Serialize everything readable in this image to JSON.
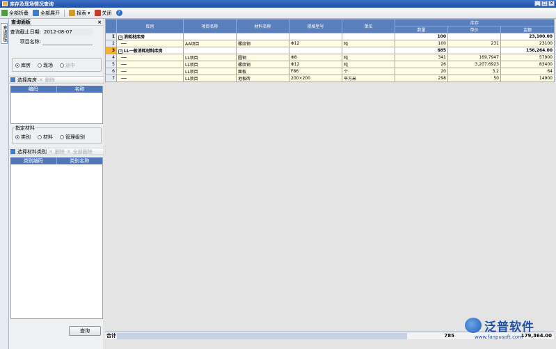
{
  "window": {
    "title": "库存及现场情况查询"
  },
  "toolbar": {
    "expand_all": "全部折叠",
    "collapse_all": "全部展开",
    "report": "报表",
    "close": "关闭",
    "help": "?"
  },
  "side_tab": {
    "label": "查询面板"
  },
  "panel": {
    "title": "查询面板",
    "close": "×",
    "date_label": "查询截止日期:",
    "date_value": "2012-08-07",
    "project_label": "项目名称:",
    "project_value": "",
    "scope_options": [
      "库房",
      "现场",
      "途中"
    ],
    "scope_selected": "库房",
    "select_warehouse": "选择库房",
    "delete": "删除",
    "wh_cols": [
      "编码",
      "名称"
    ],
    "material_group_title": "指定材料",
    "material_options": [
      "类别",
      "材料",
      "管理级别"
    ],
    "material_selected": "类别",
    "select_category": "选择材料类别",
    "delete_all": "全部删除",
    "cat_cols": [
      "类别编码",
      "类别名称"
    ],
    "query_button": "查询"
  },
  "grid": {
    "headers": {
      "warehouse": "库房",
      "project": "项目名称",
      "material": "材料名称",
      "spec": "规格型号",
      "unit": "单位",
      "stock": "库存",
      "qty": "数量",
      "price": "单价",
      "amount": "金额"
    },
    "rows": [
      {
        "n": "1",
        "warehouse": "消耗材库房",
        "project": "",
        "material": "",
        "spec": "",
        "unit": "",
        "qty": "100",
        "price": "",
        "amount": "23,100.00",
        "kind": "grp"
      },
      {
        "n": "2",
        "warehouse": "",
        "project": "AA项目",
        "material": "螺纹钢",
        "spec": "Φ12",
        "unit": "吨",
        "qty": "100",
        "price": "231",
        "amount": "23100",
        "kind": "yel"
      },
      {
        "n": "3",
        "warehouse": "LL一般消耗材料库房",
        "project": "",
        "material": "",
        "spec": "",
        "unit": "",
        "qty": "685",
        "price": "",
        "amount": "156,264.00",
        "kind": "grp sel"
      },
      {
        "n": "4",
        "warehouse": "",
        "project": "LL项目",
        "material": "圆钢",
        "spec": "Φ8",
        "unit": "吨",
        "qty": "341",
        "price": "169.7947",
        "amount": "57900",
        "kind": "yel"
      },
      {
        "n": "5",
        "warehouse": "",
        "project": "LL项目",
        "material": "螺纹钢",
        "spec": "Φ12",
        "unit": "吨",
        "qty": "26",
        "price": "3,207.6923",
        "amount": "83400",
        "kind": "yel"
      },
      {
        "n": "6",
        "warehouse": "",
        "project": "LL项目",
        "material": "面板",
        "spec": "F86",
        "unit": "个",
        "qty": "20",
        "price": "3.2",
        "amount": "64",
        "kind": "yel"
      },
      {
        "n": "7",
        "warehouse": "",
        "project": "LL项目",
        "material": "地板砖",
        "spec": "200×200",
        "unit": "平方米",
        "qty": "298",
        "price": "50",
        "amount": "14900",
        "kind": "yel"
      }
    ]
  },
  "footer": {
    "label": "合计",
    "qty": "785",
    "amount": "179,364.00"
  },
  "logo": {
    "name": "泛普软件",
    "url": "www.fanpusoft.com"
  }
}
